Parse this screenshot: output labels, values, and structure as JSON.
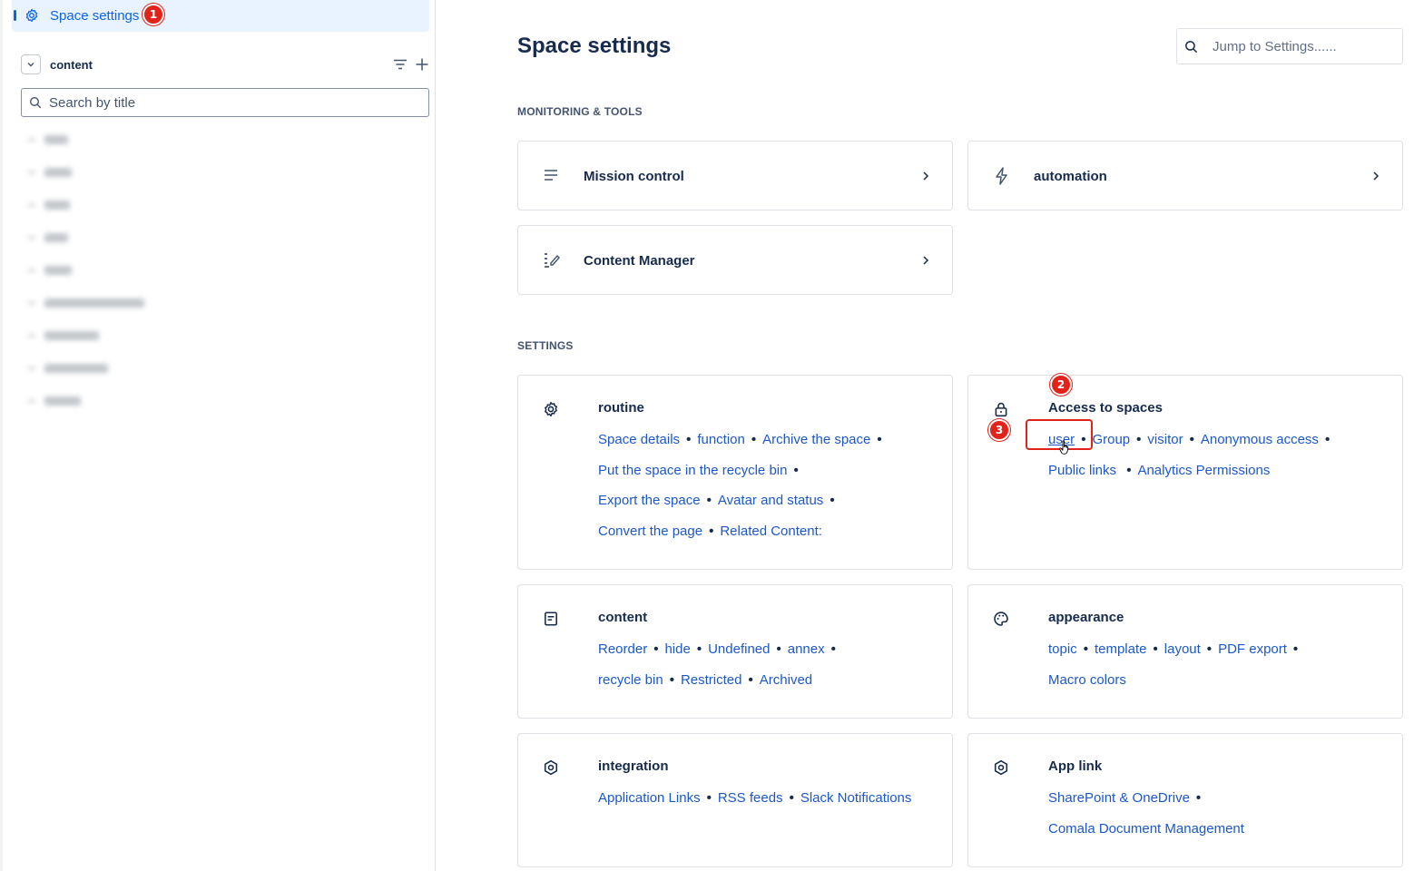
{
  "sidebar": {
    "active_item": {
      "label": "Space settings",
      "icon": "gear-icon",
      "badge": "1"
    },
    "section_label": "content",
    "search_placeholder": "Search by title"
  },
  "main": {
    "title": "Space settings",
    "jump_placeholder": "Jump to Settings......",
    "monitoring_label": "MONITORING & TOOLS",
    "tools": [
      {
        "label": "Mission control",
        "icon": "list-icon"
      },
      {
        "label": "automation",
        "icon": "lightning-icon"
      },
      {
        "label": "Content Manager",
        "icon": "edit-list-icon"
      }
    ],
    "settings_label": "SETTINGS",
    "cards": {
      "routine": {
        "title": "routine",
        "links": [
          "Space details",
          "function",
          "Archive the space",
          "Put the space in the recycle bin",
          "Export the space",
          "Avatar and status",
          "Convert the page",
          "Related Content:"
        ]
      },
      "access": {
        "title": "Access to spaces",
        "badge": "2",
        "links": [
          "user",
          "Group",
          "visitor",
          "Anonymous access",
          "Public links",
          "Analytics Permissions"
        ],
        "step_badge": "3"
      },
      "content": {
        "title": "content",
        "links": [
          "Reorder",
          "hide",
          "Undefined",
          "annex",
          "recycle bin",
          "Restricted",
          "Archived"
        ]
      },
      "appearance": {
        "title": "appearance",
        "links": [
          "topic",
          "template",
          "layout",
          "PDF export",
          "Macro colors"
        ]
      },
      "integration": {
        "title": "integration",
        "links": [
          "Application Links",
          "RSS feeds",
          "Slack Notifications"
        ]
      },
      "applink": {
        "title": "App link",
        "links": [
          "SharePoint & OneDrive",
          "Comala Document Management"
        ]
      }
    }
  },
  "colors": {
    "accent": "#0c66e4",
    "link": "#1d58c9",
    "badge": "#e2231a"
  }
}
